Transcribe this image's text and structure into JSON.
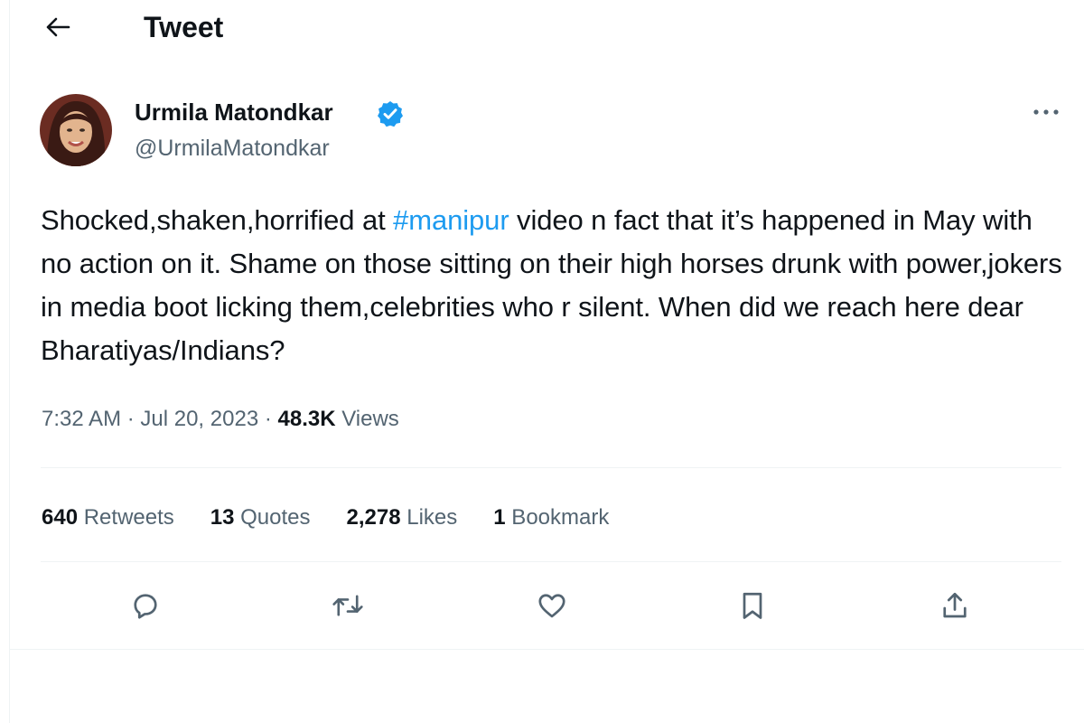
{
  "header": {
    "title": "Tweet",
    "back_icon": "arrow-left-icon"
  },
  "author": {
    "name": "Urmila Matondkar",
    "handle": "@UrmilaMatondkar",
    "verified": true,
    "verified_color": "#1d9bf0"
  },
  "tweet": {
    "text_before": "Shocked,shaken,horrified at ",
    "hashtag": "#manipur",
    "text_after": " video n fact that it’s happened in May with no action on it. Shame on those sitting on their high horses drunk with power,jokers in media boot licking them,celebrities who r silent. When did we reach here dear Bharatiyas/Indians?"
  },
  "meta": {
    "time": "7:32 AM",
    "sep1": " · ",
    "date": "Jul 20, 2023",
    "sep2": " · ",
    "views_count": "48.3K",
    "views_label": " Views"
  },
  "stats": {
    "retweets": {
      "count": "640",
      "label": " Retweets"
    },
    "quotes": {
      "count": "13",
      "label": " Quotes"
    },
    "likes": {
      "count": "2,278",
      "label": " Likes"
    },
    "bookmarks": {
      "count": "1",
      "label": " Bookmark"
    }
  },
  "actions": [
    "reply-icon",
    "retweet-icon",
    "like-icon",
    "bookmark-icon",
    "share-icon"
  ],
  "colors": {
    "accent": "#1d9bf0",
    "text": "#0f1419",
    "secondary": "#536471",
    "divider": "#eff3f4"
  }
}
